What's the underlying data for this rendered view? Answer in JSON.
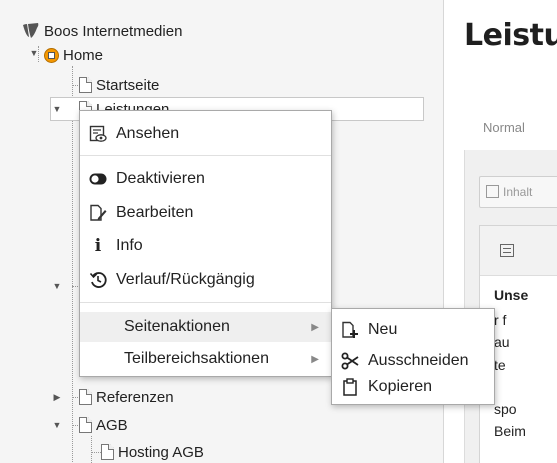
{
  "tree": {
    "root_label": "Boos Internetmedien",
    "nodes": {
      "home": "Home",
      "startseite": "Startseite",
      "leistungen": "Leistungen",
      "referenzen": "Referenzen",
      "agb": "AGB",
      "hosting_agb": "Hosting AGB"
    }
  },
  "content": {
    "title": "Leistungen",
    "tab_label": "Normal",
    "button_label": "Inhalt",
    "card_lines": [
      "Unse",
      "r f",
      "au",
      "te",
      "spo",
      "Beim"
    ]
  },
  "context_menu": {
    "items": [
      {
        "label": "Ansehen",
        "icon": "view-icon"
      },
      {
        "label": "Deaktivieren",
        "icon": "toggle-icon"
      },
      {
        "label": "Bearbeiten",
        "icon": "edit-icon"
      },
      {
        "label": "Info",
        "icon": "info-icon"
      },
      {
        "label": "Verlauf/Rückgängig",
        "icon": "history-icon"
      },
      {
        "label": "Seitenaktionen",
        "icon": "submenu-arrow-icon"
      },
      {
        "label": "Teilbereichsaktionen",
        "icon": "submenu-arrow-icon"
      }
    ]
  },
  "submenu": {
    "items": [
      {
        "label": "Neu",
        "icon": "new-page-icon"
      },
      {
        "label": "Ausschneiden",
        "icon": "scissors-icon"
      },
      {
        "label": "Kopieren",
        "icon": "clipboard-icon"
      }
    ]
  },
  "colors": {
    "tree_bg": "#f5f5f5",
    "typo3_orange": "#f49700",
    "menu_highlight": "#efefef"
  }
}
